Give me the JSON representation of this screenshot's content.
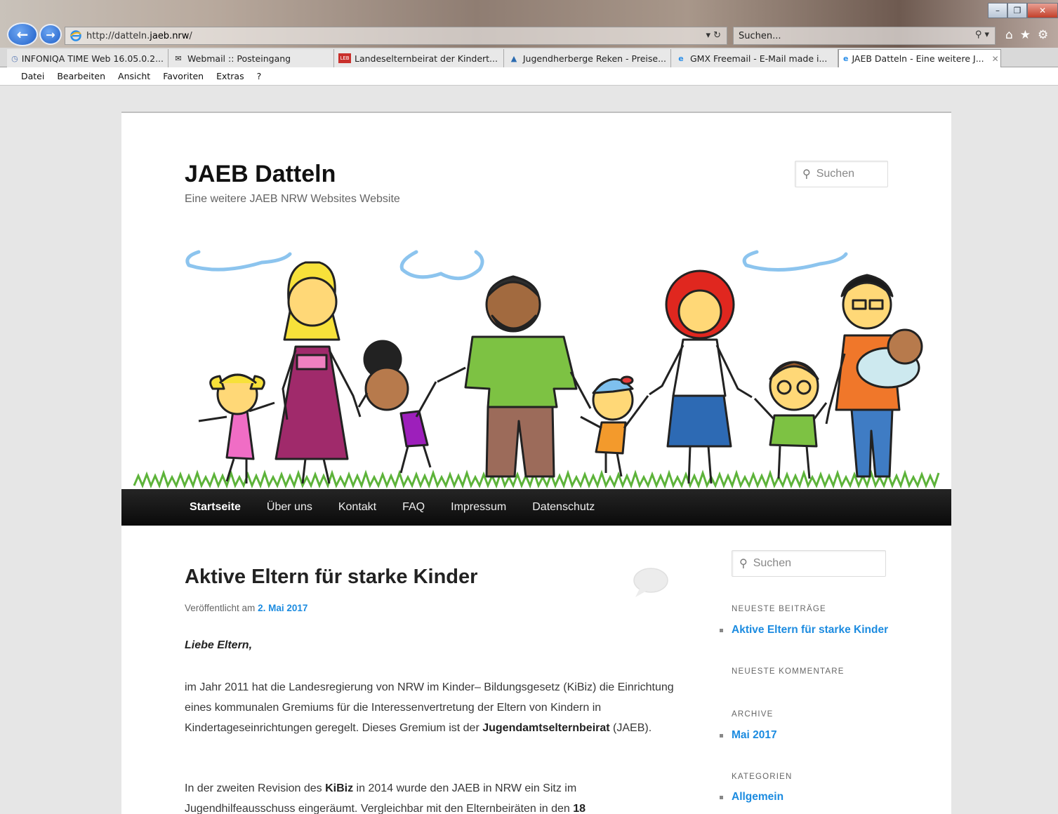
{
  "browser": {
    "url_prefix": "http://datteln.",
    "url_host": "jaeb.nrw",
    "url_suffix": "/",
    "addr_controls": "▾ ↻",
    "search_placeholder": "Suchen...",
    "window_buttons": [
      "–",
      "❐",
      "✕"
    ],
    "tabs": [
      {
        "label": "INFONIQA TIME Web 16.05.0.2...",
        "icon": "clock-icon",
        "active": false
      },
      {
        "label": "Webmail :: Posteingang",
        "icon": "mail-icon",
        "active": false
      },
      {
        "label": "Landeselternbeirat der Kindert...",
        "icon": "lebk-icon",
        "active": false
      },
      {
        "label": "Jugendherberge Reken - Preise...",
        "icon": "hostel-icon",
        "active": false
      },
      {
        "label": "GMX Freemail - E-Mail made i...",
        "icon": "ie-icon",
        "active": false
      },
      {
        "label": "JAEB Datteln - Eine weitere J...",
        "icon": "ie-icon",
        "active": true
      }
    ],
    "menu": [
      "Datei",
      "Bearbeiten",
      "Ansicht",
      "Favoriten",
      "Extras",
      "?"
    ]
  },
  "site": {
    "title": "JAEB Datteln",
    "description": "Eine weitere JAEB NRW Websites Website",
    "search_placeholder": "Suchen",
    "nav": [
      "Startseite",
      "Über uns",
      "Kontakt",
      "FAQ",
      "Impressum",
      "Datenschutz"
    ]
  },
  "post": {
    "title": "Aktive Eltern für starke Kinder",
    "meta_prefix": "Veröffentlicht am ",
    "meta_date": "2. Mai 2017",
    "greeting": "Liebe Eltern,",
    "p1_a": "im Jahr 2011 hat die Landesregierung von NRW im Kinder– Bildungsgesetz (KiBiz) die Einrichtung eines kommunalen Gremiums für die Interessenvertretung der Eltern von Kindern in Kindertageseinrichtungen geregelt. Dieses Gremium ist der ",
    "p1_b": "Jugendamtselternbeirat",
    "p1_c": " (JAEB).",
    "p2_a": "In der zweiten Revision des ",
    "p2_b": "KiBiz",
    "p2_c": " in 2014 wurde den JAEB in NRW ein Sitz im Jugendhilfeausschuss eingeräumt. Vergleichbar mit den Elternbeiräten in den ",
    "p2_d": "18"
  },
  "sidebar": {
    "search_placeholder": "Suchen",
    "recent_posts_title": "NEUESTE BEITRÄGE",
    "recent_posts": [
      "Aktive Eltern für starke Kinder"
    ],
    "recent_comments_title": "NEUESTE KOMMENTARE",
    "archives_title": "ARCHIVE",
    "archives": [
      "Mai 2017"
    ],
    "categories_title": "KATEGORIEN",
    "categories": [
      "Allgemein"
    ]
  },
  "colors": {
    "link": "#1b8be0",
    "nav_bg": "#111111",
    "grass": "#5db33a",
    "cloud": "#8cc4ee"
  }
}
